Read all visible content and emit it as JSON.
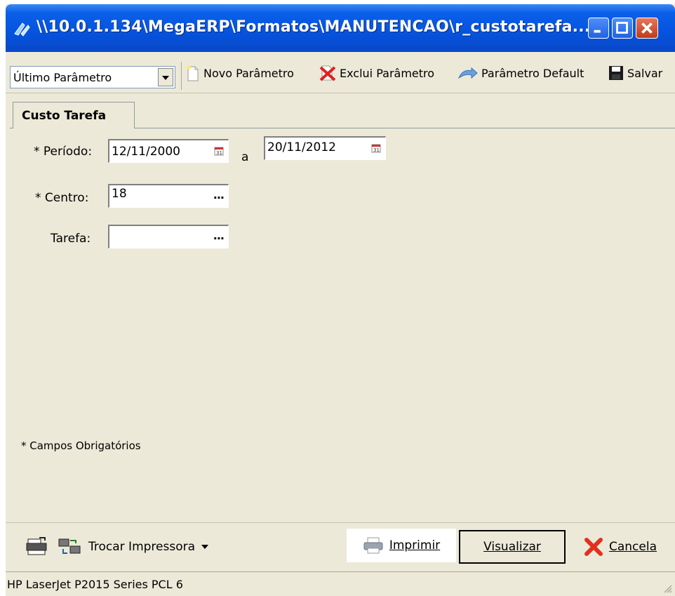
{
  "window": {
    "title": "\\\\10.0.1.134\\MegaERP\\Formatos\\MANUTENCAO\\r_custotarefa..."
  },
  "toolbar": {
    "combo_value": "Último Parâmetro",
    "novo_label": "Novo Parâmetro",
    "exclui_label": "Exclui Parâmetro",
    "default_label": "Parâmetro Default",
    "salvar_label": "Salvar"
  },
  "tabs": [
    {
      "label": "Custo Tarefa",
      "active": true
    }
  ],
  "form": {
    "periodo_label": "* Período:",
    "periodo_from": "12/11/2000",
    "periodo_sep": "a",
    "periodo_to": "20/11/2012",
    "centro_label": "* Centro:",
    "centro_value": "18",
    "tarefa_label": "Tarefa:",
    "tarefa_value": "",
    "lookup_dots": "..."
  },
  "footnote": "* Campos Obrigatórios",
  "bottom": {
    "trocar_label": "Trocar Impressora",
    "imprimir_label": "Imprimir",
    "visualizar_label": "Visualizar",
    "cancela_label": "Cancela"
  },
  "status": {
    "printer": "HP LaserJet P2015 Series PCL 6"
  },
  "colors": {
    "titlebar": "#0553de",
    "window_bg": "#ece9d8",
    "close_red": "#c23a17"
  },
  "icons": [
    "app-icon",
    "minimize-icon",
    "maximize-icon",
    "close-icon",
    "new-document-icon",
    "delete-icon",
    "default-arrow-icon",
    "save-icon",
    "calendar-icon",
    "printer-settings-icon",
    "swap-printer-icon",
    "printer-icon",
    "cancel-x-icon",
    "resize-grip-icon"
  ]
}
